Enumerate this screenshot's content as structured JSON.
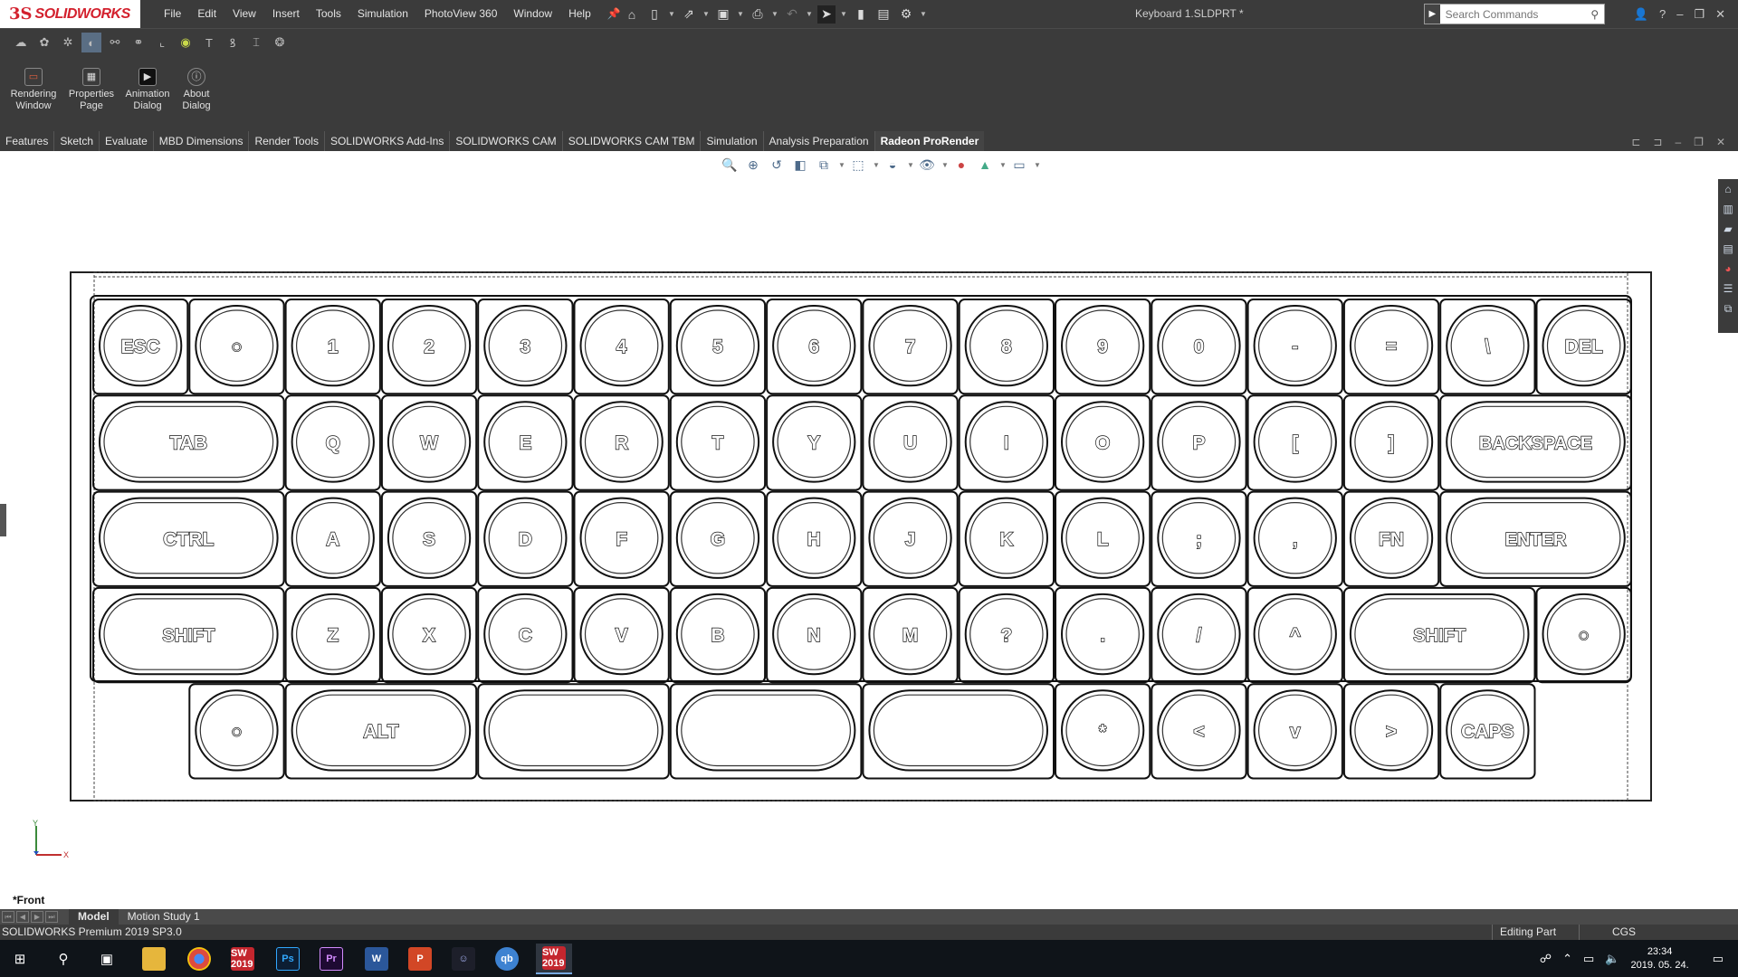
{
  "app": {
    "brand_ds": "3S",
    "brand_name": "SOLIDWORKS",
    "document_title": "Keyboard 1.SLDPRT *"
  },
  "menu": [
    "File",
    "Edit",
    "View",
    "Insert",
    "Tools",
    "Simulation",
    "PhotoView 360",
    "Window",
    "Help"
  ],
  "search": {
    "placeholder": "Search Commands"
  },
  "ribbon": [
    {
      "label_line1": "Rendering",
      "label_line2": "Window"
    },
    {
      "label_line1": "Properties",
      "label_line2": "Page"
    },
    {
      "label_line1": "Animation",
      "label_line2": "Dialog"
    },
    {
      "label_line1": "About",
      "label_line2": "Dialog"
    }
  ],
  "tabs": [
    "Features",
    "Sketch",
    "Evaluate",
    "MBD Dimensions",
    "Render Tools",
    "SOLIDWORKS Add-Ins",
    "SOLIDWORKS CAM",
    "SOLIDWORKS CAM TBM",
    "Simulation",
    "Analysis Preparation",
    "Radeon ProRender"
  ],
  "active_tab": "Radeon ProRender",
  "keyboard": {
    "rows": [
      [
        {
          "l": "ESC"
        },
        {
          "l": "○"
        },
        {
          "l": "1"
        },
        {
          "l": "2"
        },
        {
          "l": "3"
        },
        {
          "l": "4"
        },
        {
          "l": "5"
        },
        {
          "l": "6"
        },
        {
          "l": "7"
        },
        {
          "l": "8"
        },
        {
          "l": "9"
        },
        {
          "l": "0"
        },
        {
          "l": "-"
        },
        {
          "l": "="
        },
        {
          "l": "\\"
        },
        {
          "l": "DEL"
        }
      ],
      [
        {
          "l": "TAB",
          "w": 2
        },
        {
          "l": "Q"
        },
        {
          "l": "W"
        },
        {
          "l": "E"
        },
        {
          "l": "R"
        },
        {
          "l": "T"
        },
        {
          "l": "Y"
        },
        {
          "l": "U"
        },
        {
          "l": "I"
        },
        {
          "l": "O"
        },
        {
          "l": "P"
        },
        {
          "l": "["
        },
        {
          "l": "]"
        },
        {
          "l": "BACKSPACE",
          "w": 2
        }
      ],
      [
        {
          "l": "CTRL",
          "w": 2
        },
        {
          "l": "A"
        },
        {
          "l": "S"
        },
        {
          "l": "D"
        },
        {
          "l": "F"
        },
        {
          "l": "G"
        },
        {
          "l": "H"
        },
        {
          "l": "J"
        },
        {
          "l": "K"
        },
        {
          "l": "L"
        },
        {
          "l": ";"
        },
        {
          "l": ","
        },
        {
          "l": "FN"
        },
        {
          "l": "ENTER",
          "w": 2
        }
      ],
      [
        {
          "l": "SHIFT",
          "w": 2
        },
        {
          "l": "Z"
        },
        {
          "l": "X"
        },
        {
          "l": "C"
        },
        {
          "l": "V"
        },
        {
          "l": "B"
        },
        {
          "l": "N"
        },
        {
          "l": "M"
        },
        {
          "l": "?"
        },
        {
          "l": "."
        },
        {
          "l": "/"
        },
        {
          "l": "^"
        },
        {
          "l": "SHIFT",
          "w": 2
        },
        {
          "l": "○"
        }
      ],
      [
        {
          "l": "",
          "gap": 1
        },
        {
          "l": "○"
        },
        {
          "l": "ALT",
          "w": 2
        },
        {
          "l": "",
          "w": 2
        },
        {
          "l": "",
          "w": 2
        },
        {
          "l": "",
          "w": 2
        },
        {
          "l": "*"
        },
        {
          "l": "<"
        },
        {
          "l": "v"
        },
        {
          "l": ">"
        },
        {
          "l": "CAPS"
        }
      ]
    ]
  },
  "view": {
    "name": "*Front",
    "axis_x": "X",
    "axis_y": "Y"
  },
  "bottom_tabs": [
    "Model",
    "Motion Study 1"
  ],
  "status": {
    "product": "SOLIDWORKS Premium 2019 SP3.0",
    "mode": "Editing Part",
    "units": "CGS"
  },
  "taskbar_apps": [
    "SW 2019",
    "Ps",
    "Pr",
    "W",
    "P",
    "qb",
    "SW 2019"
  ],
  "clock": {
    "time": "23:34",
    "date": "2019. 05. 24."
  }
}
